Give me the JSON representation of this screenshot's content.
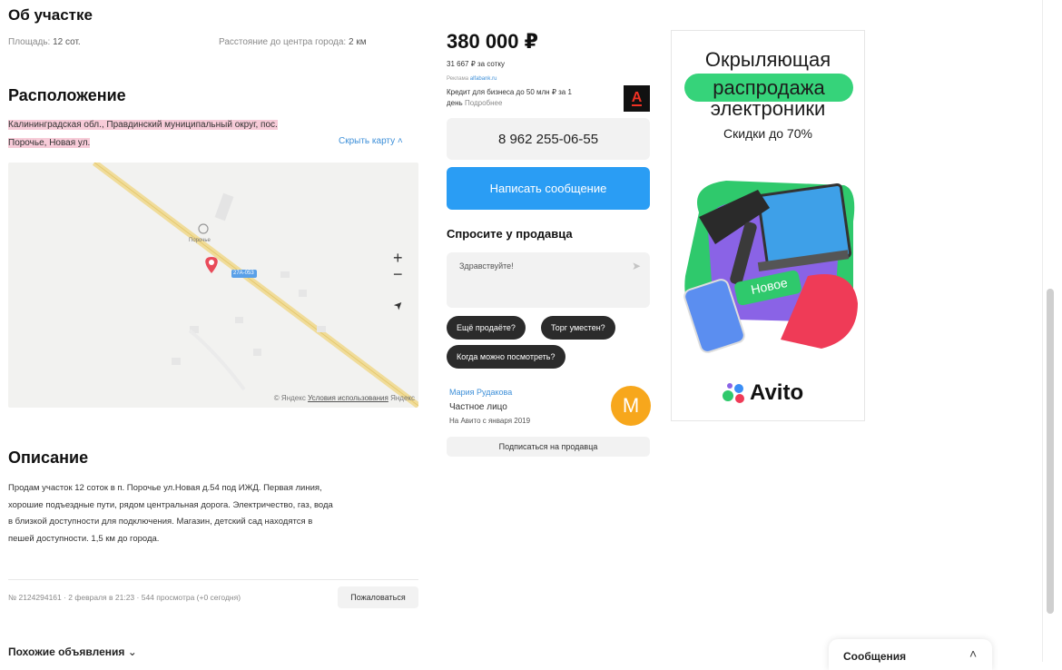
{
  "plot": {
    "heading": "Об участке",
    "area_label": "Площадь:",
    "area_value": "12 сот.",
    "distance_label": "Расстояние до центра города:",
    "distance_value": "2 км"
  },
  "location": {
    "heading": "Расположение",
    "address_line1": "Калининградская обл., Правдинский муниципальный округ, пос.",
    "address_line2": "Порочье, Новая ул.",
    "hide_map": "Скрыть карту",
    "map_village": "Порочье",
    "map_road": "27А-053",
    "zoom_in": "+",
    "zoom_out": "−",
    "locate": "➤",
    "map_copyright": "© Яндекс",
    "map_terms": "Условия использования",
    "map_brand": "Яндекс"
  },
  "description": {
    "heading": "Описание",
    "line1": "Продам участок 12 соток в п. Порочье ул.Новая д.54 под ИЖД. Первая линия,",
    "line2": "хорошие подъездные пути, рядом центральная дорога. Электричество, газ, вода",
    "line3": "в близкой доступности для подключения. Магазин, детский сад находятся в",
    "line4": "пешей доступности. 1,5 км до города."
  },
  "meta": {
    "listing_info": "№ 2124294161 · 2 февраля в 21:23 · 544 просмотра (+0 сегодня)",
    "report": "Пожаловаться"
  },
  "similar": {
    "label": "Похожие объявления"
  },
  "price": {
    "value": "380 000 ₽",
    "per_unit": "31 667 ₽ за сотку",
    "ad_label": "Реклама",
    "ad_domain": "alfabank.ru",
    "credit_line1": "Кредит для бизнеса до 50 млн ₽ за 1",
    "credit_line2": "день",
    "credit_more": "Подробнее",
    "bank_logo": "А"
  },
  "contact": {
    "phone": "8 962 255-06-55",
    "write_message": "Написать сообщение",
    "ask_heading": "Спросите у продавца",
    "ask_placeholder": "Здравствуйте!",
    "chips": [
      "Ещё продаёте?",
      "Торг уместен?",
      "Когда можно посмотреть?"
    ]
  },
  "seller": {
    "name": "Мария Рудакова",
    "type": "Частное лицо",
    "since": "На Авито с января 2019",
    "avatar_letter": "М",
    "subscribe": "Подписаться на продавца"
  },
  "banner": {
    "line1": "Окрыляющая",
    "line2": "распродажа",
    "line3": "электроники",
    "discount": "Скидки до 70%",
    "badge": "Новое",
    "brand": "Avito",
    "accent": "#36d37a"
  },
  "chat": {
    "label": "Сообщения"
  },
  "colors": {
    "primary_button": "#2a9df4",
    "avatar": "#f7a71c",
    "highlight": "#f7cbd8"
  }
}
